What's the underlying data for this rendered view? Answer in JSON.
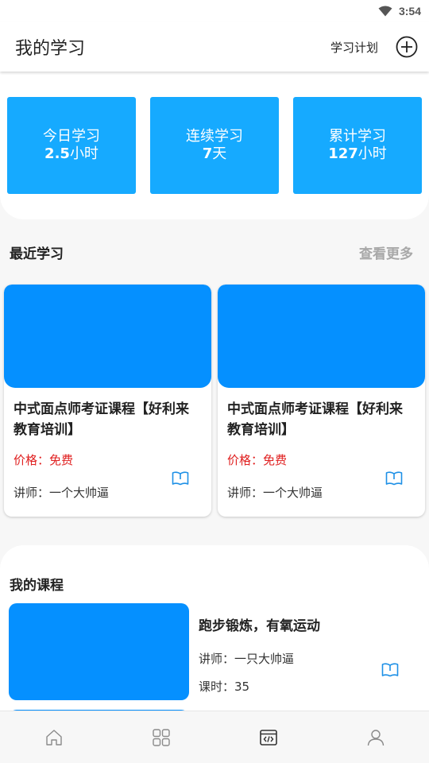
{
  "status_bar": {
    "time": "3:54",
    "wifi_icon": "wifi-icon"
  },
  "header": {
    "title": "我的学习",
    "plan_label": "学习计划",
    "add_icon": "add-circle-icon"
  },
  "stats": [
    {
      "label": "今日学习",
      "value": "2.5",
      "unit": "小时"
    },
    {
      "label": "连续学习",
      "value": "7",
      "unit": "天"
    },
    {
      "label": "累计学习",
      "value": "127",
      "unit": "小时"
    }
  ],
  "recent": {
    "title": "最近学习",
    "more_label": "查看更多",
    "cards": [
      {
        "title": "中式面点师考证课程【好利来教育培训】",
        "price": "价格：免费",
        "teacher": "讲师：一个大帅逼",
        "icon": "book-icon"
      },
      {
        "title": "中式面点师考证课程【好利来教育培训】",
        "price": "价格：免费",
        "teacher": "讲师：一个大帅逼",
        "icon": "book-icon"
      }
    ]
  },
  "my_courses": {
    "title": "我的课程",
    "items": [
      {
        "name": "跑步锻炼，有氧运动",
        "teacher": "讲师：一只大帅逼",
        "lessons": "课时：35",
        "icon": "book-icon"
      }
    ]
  },
  "bottom_nav": {
    "tabs": [
      {
        "icon": "home-icon"
      },
      {
        "icon": "grid-icon"
      },
      {
        "icon": "code-icon"
      },
      {
        "icon": "user-icon"
      }
    ]
  },
  "colors": {
    "accent": "#16aaff",
    "thumb": "#0590ff",
    "price": "#e02020"
  }
}
